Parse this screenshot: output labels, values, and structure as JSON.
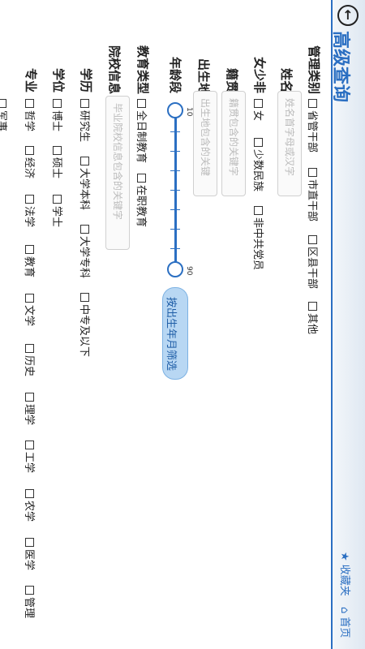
{
  "header": {
    "title": "高级查询",
    "back_icon": "back-arrow-icon",
    "favorites_label": "收藏夹",
    "home_label": "首页",
    "accent": "#2b6fc2"
  },
  "filters": {
    "management": {
      "label": "管理类别",
      "options": [
        "省管干部",
        "市直干部",
        "区县干部",
        "其他"
      ]
    },
    "name": {
      "label": "姓名",
      "placeholder": "姓名首字母或汉字"
    },
    "special": {
      "label": "女少非",
      "options": [
        "女",
        "少数民族",
        "非中共党员"
      ]
    },
    "native": {
      "label": "籍贯",
      "placeholder": "籍贯包含的关键字"
    },
    "birthplace": {
      "label": "出生地",
      "placeholder": "出生地包含的关键"
    },
    "age": {
      "label": "年龄段",
      "min": "10",
      "max": "90",
      "range": [
        10,
        90
      ]
    },
    "filter_button": "按出生年月筛选",
    "edu_type": {
      "label": "教育类型",
      "options": [
        "全日制教育",
        "在职教育"
      ]
    },
    "school": {
      "label": "院校信息",
      "placeholder": "毕业院校信息包含的关键字"
    },
    "education": {
      "label": "学历",
      "options": [
        "研究生",
        "大学本科",
        "大学专科",
        "中专及以下"
      ]
    },
    "degree": {
      "label": "学位",
      "options": [
        "博士",
        "硕士",
        "学士"
      ]
    },
    "major": {
      "label": "专业",
      "options": [
        "哲学",
        "经济",
        "法学",
        "教育",
        "文学",
        "历史",
        "理学",
        "工学",
        "农学",
        "医学",
        "管理",
        "军事"
      ]
    }
  }
}
